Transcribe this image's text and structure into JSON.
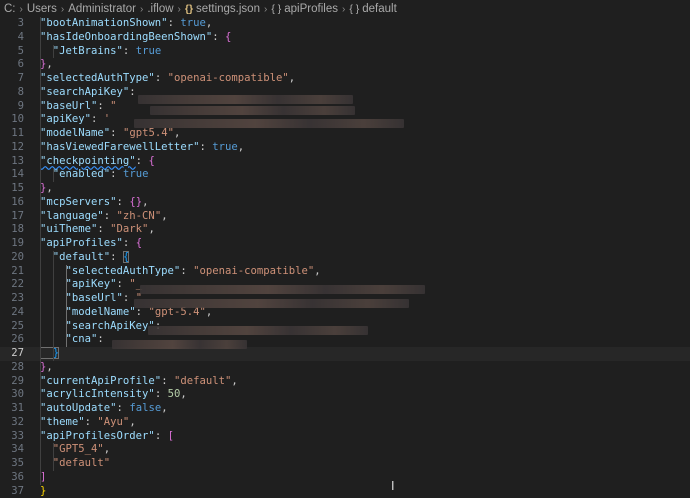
{
  "breadcrumb": {
    "drive": "C:",
    "users": "Users",
    "user": "Administrator",
    "folder": ".iflow",
    "file": "settings.json",
    "node1": "apiProfiles",
    "node2": "default",
    "file_icon": "json-braces-icon",
    "object_icon": "object-braces-icon"
  },
  "editor": {
    "lines": [
      {
        "n": "3",
        "t": [
          [
            "k",
            "\"bootAnimationShown\""
          ],
          [
            "p",
            ": "
          ],
          [
            "b",
            "true"
          ],
          [
            "p",
            ","
          ]
        ]
      },
      {
        "n": "4",
        "t": [
          [
            "k",
            "\"hasIdeOnboardingBeenShown\""
          ],
          [
            "p",
            ": "
          ],
          [
            "br2",
            "{"
          ]
        ]
      },
      {
        "n": "5",
        "t": [
          [
            "k",
            "  \"JetBrains\""
          ],
          [
            "p",
            ": "
          ],
          [
            "b",
            "true"
          ]
        ]
      },
      {
        "n": "6",
        "t": [
          [
            "br2",
            "}"
          ],
          [
            "p",
            ","
          ]
        ]
      },
      {
        "n": "7",
        "t": [
          [
            "k",
            "\"selectedAuthType\""
          ],
          [
            "p",
            ": "
          ],
          [
            "s",
            "\"openai-compatible\""
          ],
          [
            "p",
            ","
          ]
        ]
      },
      {
        "n": "8",
        "t": [
          [
            "k",
            "\"searchApiKey\""
          ],
          [
            "p",
            ": "
          ]
        ]
      },
      {
        "n": "9",
        "t": [
          [
            "k",
            "\"baseUrl\""
          ],
          [
            "p",
            ": "
          ],
          [
            "s",
            "\""
          ]
        ]
      },
      {
        "n": "10",
        "t": [
          [
            "k",
            "\"apiKey\""
          ],
          [
            "p",
            ": "
          ],
          [
            "s",
            "'"
          ]
        ]
      },
      {
        "n": "11",
        "t": [
          [
            "k",
            "\"modelName\""
          ],
          [
            "p",
            ": "
          ],
          [
            "s",
            "\"gpt5.4\""
          ],
          [
            "p",
            ","
          ]
        ]
      },
      {
        "n": "12",
        "t": [
          [
            "k",
            "\"hasViewedFarewellLetter\""
          ],
          [
            "p",
            ": "
          ],
          [
            "b",
            "true"
          ],
          [
            "p",
            ","
          ]
        ]
      },
      {
        "n": "13",
        "t": [
          [
            "ksq",
            "\"checkpointing\""
          ],
          [
            "p",
            ": "
          ],
          [
            "br2",
            "{"
          ]
        ]
      },
      {
        "n": "14",
        "t": [
          [
            "k",
            "  \"enabled\""
          ],
          [
            "p",
            ": "
          ],
          [
            "b",
            "true"
          ]
        ]
      },
      {
        "n": "15",
        "t": [
          [
            "br2",
            "}"
          ],
          [
            "p",
            ","
          ]
        ]
      },
      {
        "n": "16",
        "t": [
          [
            "k",
            "\"mcpServers\""
          ],
          [
            "p",
            ": "
          ],
          [
            "br2",
            "{}"
          ],
          [
            "p",
            ","
          ]
        ]
      },
      {
        "n": "17",
        "t": [
          [
            "k",
            "\"language\""
          ],
          [
            "p",
            ": "
          ],
          [
            "s",
            "\"zh-CN\""
          ],
          [
            "p",
            ","
          ]
        ]
      },
      {
        "n": "18",
        "t": [
          [
            "k",
            "\"uiTheme\""
          ],
          [
            "p",
            ": "
          ],
          [
            "s",
            "\"Dark\""
          ],
          [
            "p",
            ","
          ]
        ]
      },
      {
        "n": "19",
        "t": [
          [
            "k",
            "\"apiProfiles\""
          ],
          [
            "p",
            ": "
          ],
          [
            "br2",
            "{"
          ]
        ]
      },
      {
        "n": "20",
        "t": [
          [
            "k",
            "  \"default\""
          ],
          [
            "p",
            ": "
          ],
          [
            "br3box",
            "{"
          ]
        ]
      },
      {
        "n": "21",
        "t": [
          [
            "k",
            "    \"selectedAuthType\""
          ],
          [
            "p",
            ": "
          ],
          [
            "s",
            "\"openai-compatible\""
          ],
          [
            "p",
            ","
          ]
        ]
      },
      {
        "n": "22",
        "t": [
          [
            "k",
            "    \"apiKey\""
          ],
          [
            "p",
            ": "
          ],
          [
            "s",
            "\"_"
          ]
        ]
      },
      {
        "n": "23",
        "t": [
          [
            "k",
            "    \"baseUrl\""
          ],
          [
            "p",
            ": "
          ],
          [
            "s",
            "\""
          ]
        ]
      },
      {
        "n": "24",
        "t": [
          [
            "k",
            "    \"modelName\""
          ],
          [
            "p",
            ": "
          ],
          [
            "s",
            "\"gpt-5.4\""
          ],
          [
            "p",
            ","
          ]
        ]
      },
      {
        "n": "25",
        "t": [
          [
            "k",
            "    \"searchApiKey\""
          ],
          [
            "p",
            ": "
          ]
        ]
      },
      {
        "n": "26",
        "t": [
          [
            "k",
            "    \"cna\""
          ],
          [
            "p",
            ": "
          ]
        ]
      },
      {
        "n": "27",
        "t": [
          [
            "br3box",
            "  }"
          ]
        ]
      },
      {
        "n": "28",
        "t": [
          [
            "br2",
            "}"
          ],
          [
            "p",
            ","
          ]
        ]
      },
      {
        "n": "29",
        "t": [
          [
            "k",
            "\"currentApiProfile\""
          ],
          [
            "p",
            ": "
          ],
          [
            "s",
            "\"default\""
          ],
          [
            "p",
            ","
          ]
        ]
      },
      {
        "n": "30",
        "t": [
          [
            "k",
            "\"acrylicIntensity\""
          ],
          [
            "p",
            ": "
          ],
          [
            "n",
            "50"
          ],
          [
            "p",
            ","
          ]
        ]
      },
      {
        "n": "31",
        "t": [
          [
            "k",
            "\"autoUpdate\""
          ],
          [
            "p",
            ": "
          ],
          [
            "b",
            "false"
          ],
          [
            "p",
            ","
          ]
        ]
      },
      {
        "n": "32",
        "t": [
          [
            "k",
            "\"theme\""
          ],
          [
            "p",
            ": "
          ],
          [
            "s",
            "\"Ayu\""
          ],
          [
            "p",
            ","
          ]
        ]
      },
      {
        "n": "33",
        "t": [
          [
            "k",
            "\"apiProfilesOrder\""
          ],
          [
            "p",
            ": "
          ],
          [
            "br2",
            "["
          ]
        ]
      },
      {
        "n": "34",
        "t": [
          [
            "s",
            "  \"GPT5_4\""
          ],
          [
            "p",
            ","
          ]
        ]
      },
      {
        "n": "35",
        "t": [
          [
            "s",
            "  \"default\""
          ]
        ]
      },
      {
        "n": "36",
        "t": [
          [
            "br2",
            "]"
          ]
        ]
      },
      {
        "n": "37",
        "t": [
          [
            "br1",
            "}"
          ]
        ]
      }
    ],
    "active_line": "27",
    "cursor_icon": "text-cursor-icon"
  }
}
